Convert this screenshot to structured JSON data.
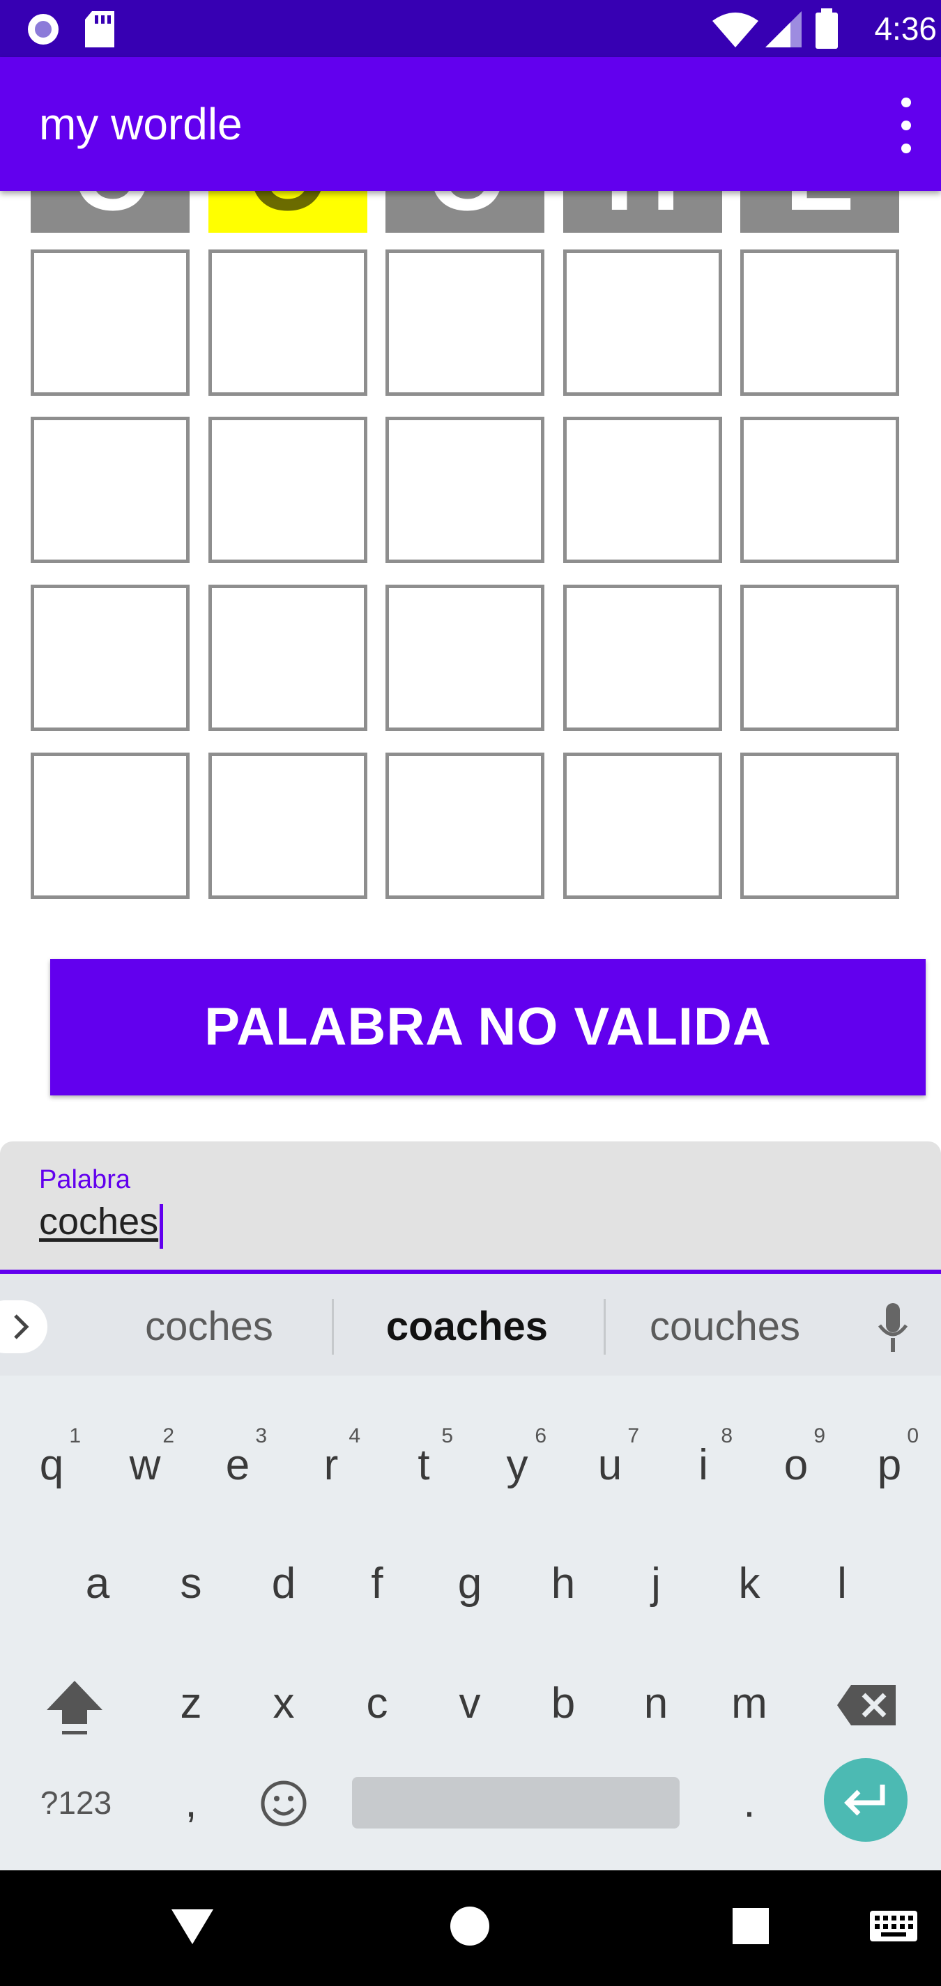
{
  "status_bar": {
    "time": "4:36"
  },
  "app_bar": {
    "title": "my wordle"
  },
  "board": {
    "rows": 5,
    "columns": 5,
    "guess_row": {
      "letters": [
        "C",
        "O",
        "C",
        "H",
        "E"
      ],
      "states": [
        "absent",
        "present",
        "absent",
        "absent",
        "absent"
      ]
    }
  },
  "submit_button": {
    "label": "PALABRA NO VALIDA"
  },
  "word_field": {
    "label": "Palabra",
    "value": "coches"
  },
  "keyboard": {
    "suggestions": [
      "coches",
      "coaches",
      "couches"
    ],
    "row1": [
      {
        "key": "q",
        "hint": "1"
      },
      {
        "key": "w",
        "hint": "2"
      },
      {
        "key": "e",
        "hint": "3"
      },
      {
        "key": "r",
        "hint": "4"
      },
      {
        "key": "t",
        "hint": "5"
      },
      {
        "key": "y",
        "hint": "6"
      },
      {
        "key": "u",
        "hint": "7"
      },
      {
        "key": "i",
        "hint": "8"
      },
      {
        "key": "o",
        "hint": "9"
      },
      {
        "key": "p",
        "hint": "0"
      }
    ],
    "row2": [
      "a",
      "s",
      "d",
      "f",
      "g",
      "h",
      "j",
      "k",
      "l"
    ],
    "row3": [
      "z",
      "x",
      "c",
      "v",
      "b",
      "n",
      "m"
    ],
    "symbols_label": "?123",
    "comma": ",",
    "period": "."
  },
  "colors": {
    "status_bar": "#3700b3",
    "primary": "#6200ee",
    "tile_absent": "#8a8a8a",
    "tile_present": "#ffff00",
    "enter_key": "#4cbab3"
  }
}
